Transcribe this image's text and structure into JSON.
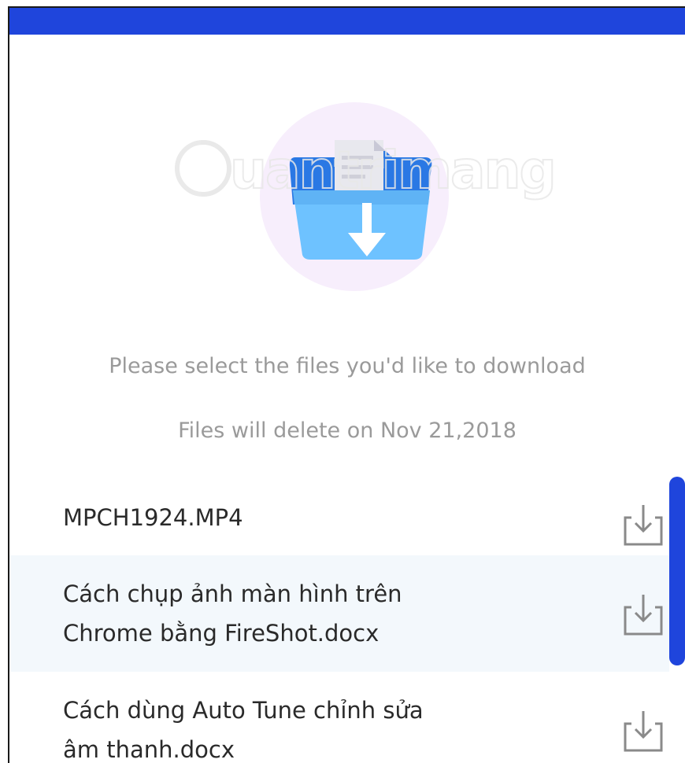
{
  "header": {
    "bar_color": "#1f45dc"
  },
  "hero": {
    "icon": "folder-download-icon",
    "watermark_text": "uantrimang"
  },
  "messages": {
    "select": "Please select the files you'd like to download",
    "delete": "Files will delete on Nov 21,2018"
  },
  "files": [
    {
      "name_lines": [
        "MPCH1924.MP4"
      ],
      "action_icon": "download-icon"
    },
    {
      "name_lines": [
        "Cách chụp ảnh màn hình trên",
        "Chrome bằng FireShot.docx"
      ],
      "action_icon": "download-icon"
    },
    {
      "name_lines": [
        "Cách dùng Auto Tune chỉnh sửa",
        "âm thanh.docx"
      ],
      "action_icon": "download-icon"
    }
  ],
  "colors": {
    "accent": "#1f45dc",
    "highlight_row": "#f3f8fc",
    "muted_text": "#9a9a9a"
  }
}
